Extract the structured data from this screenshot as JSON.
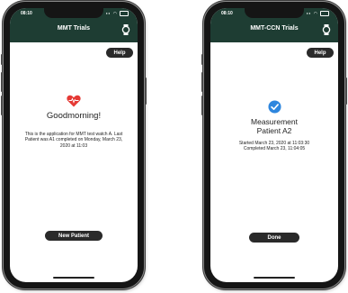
{
  "left_phone": {
    "status_time": "08:10",
    "app_title": "MMT Trials",
    "help_label": "Help",
    "heading": "Goodmorning!",
    "body": "This is the application for MMT test watch A. Last Patient was A1 completed on Monday, March 23, 2020 at 11:03",
    "button_label": "New Patient",
    "colors": {
      "appbar": "#1e3d33",
      "heart": "#e53935"
    },
    "icons": [
      "heart-ecg-icon",
      "watch-icon"
    ]
  },
  "right_phone": {
    "status_time": "08:10",
    "app_title": "MMT-CCN Trials",
    "help_label": "Help",
    "heading_line1": "Measurement",
    "heading_line2": "Patient A2",
    "body_line1": "Started March 23, 2020 at 11:03:30",
    "body_line2": "Completed March 23, 11:04:05",
    "button_label": "Done",
    "colors": {
      "appbar": "#1e3d33",
      "check": "#2e86de"
    },
    "icons": [
      "check-circle-icon",
      "watch-icon"
    ]
  }
}
